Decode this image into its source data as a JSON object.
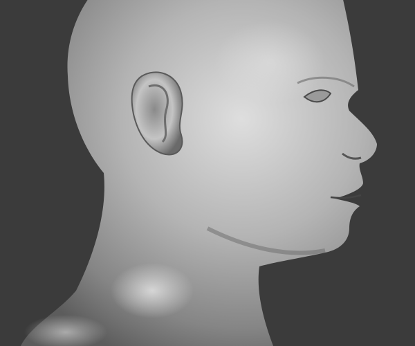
{
  "scene": {
    "subject": "sculpted-head-profile",
    "colors": {
      "background": "#3b3b3b",
      "clay_light": "#dcdcdc",
      "clay_mid": "#a9a9a9",
      "clay_dark": "#5a5a5a"
    }
  }
}
